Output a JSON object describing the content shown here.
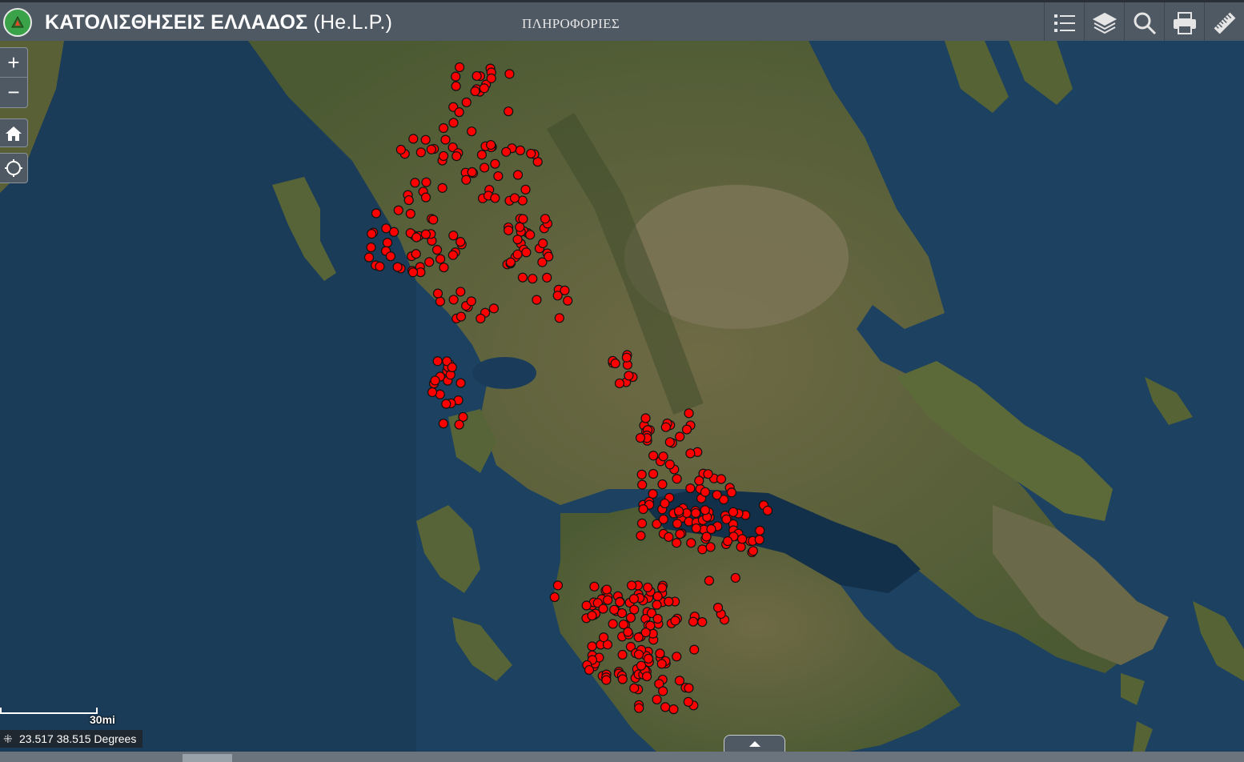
{
  "header": {
    "title_main": "ΚΑΤΟΛΙΣΘΗΣΕΙΣ ΕΛΛΑΔΟΣ",
    "title_sub": "(He.L.P.)",
    "info_link": "ΠΛΗΡΟΦΟΡΙΕΣ",
    "tools": [
      "legend-icon",
      "layers-icon",
      "search-icon",
      "print-icon",
      "measure-icon"
    ]
  },
  "controls": {
    "zoom_in": "+",
    "zoom_out": "−"
  },
  "scalebar": {
    "label": "30mi"
  },
  "coordinates": {
    "text": "23.517 38.515 Degrees"
  },
  "colors": {
    "header_bg": "#4f5964",
    "landslide_marker": "#ff0000",
    "sea": "#1c3d5a"
  }
}
